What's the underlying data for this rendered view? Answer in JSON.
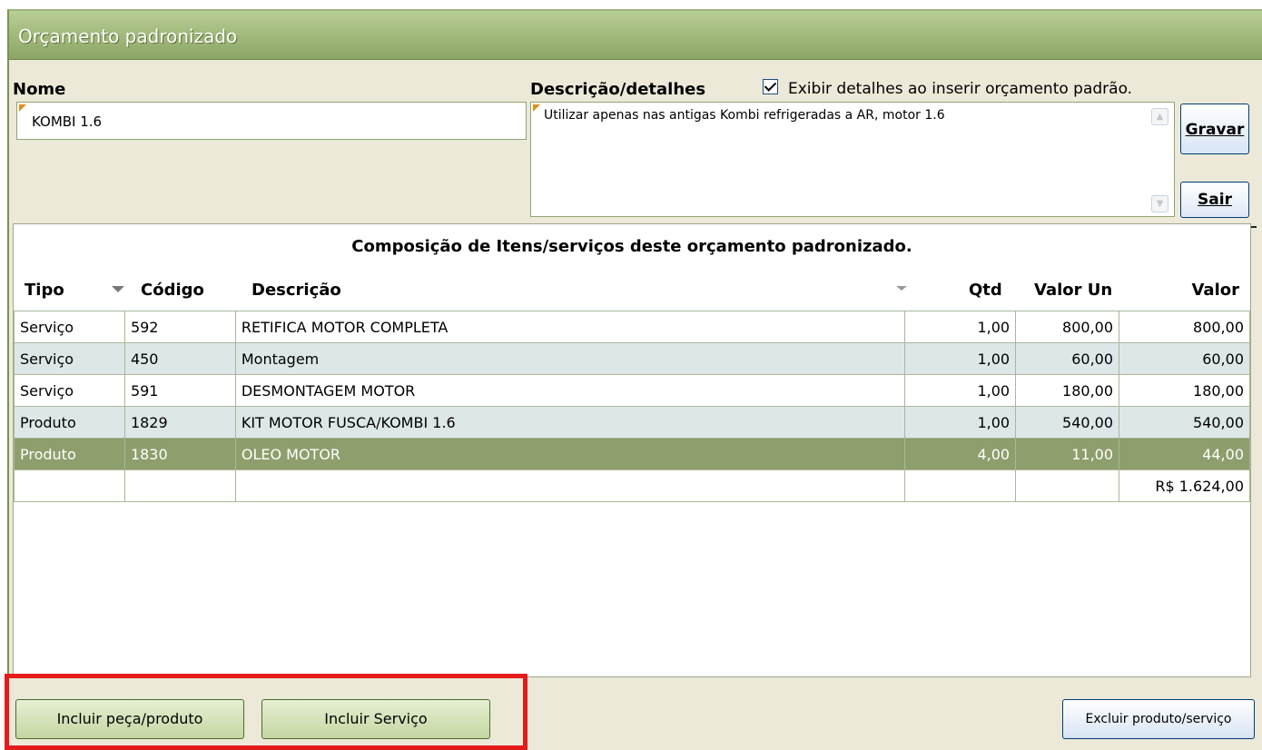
{
  "window": {
    "title": "Orçamento padronizado"
  },
  "form": {
    "nome_label": "Nome",
    "nome_value": "KOMBI 1.6",
    "descricao_label": "Descrição/detalhes",
    "descricao_value": "Utilizar apenas nas antigas Kombi refrigeradas a AR, motor 1.6",
    "exibir_label": "Exibir detalhes ao inserir orçamento padrão.",
    "exibir_checked": true
  },
  "buttons": {
    "gravar_label": "Gravar",
    "sair_label": "Sair",
    "incluir_peca_label": "Incluir peça/produto",
    "incluir_servico_label": "Incluir Serviço",
    "excluir_label": "Excluir produto/serviço"
  },
  "grid": {
    "title": "Composição de Itens/serviços deste orçamento padronizado.",
    "columns": [
      "Tipo",
      "Código",
      "Descrição",
      "Qtd",
      "Valor Un",
      "Valor"
    ],
    "rows": [
      {
        "tipo": "Serviço",
        "codigo": "592",
        "descricao": "RETIFICA MOTOR COMPLETA",
        "qtd": "1,00",
        "valor_un": "800,00",
        "valor": "800,00"
      },
      {
        "tipo": "Serviço",
        "codigo": "450",
        "descricao": "Montagem",
        "qtd": "1,00",
        "valor_un": "60,00",
        "valor": "60,00"
      },
      {
        "tipo": "Serviço",
        "codigo": "591",
        "descricao": "DESMONTAGEM MOTOR",
        "qtd": "1,00",
        "valor_un": "180,00",
        "valor": "180,00"
      },
      {
        "tipo": "Produto",
        "codigo": "1829",
        "descricao": "KIT MOTOR FUSCA/KOMBI 1.6",
        "qtd": "1,00",
        "valor_un": "540,00",
        "valor": "540,00"
      },
      {
        "tipo": "Produto",
        "codigo": "1830",
        "descricao": "OLEO MOTOR",
        "qtd": "4,00",
        "valor_un": "11,00",
        "valor": "44,00"
      }
    ],
    "total": "R$ 1.624,00"
  },
  "colors": {
    "titlebar": "#a4bb7e",
    "selected_row": "#8e9e6c",
    "alt_row": "#dde7e7",
    "highlight": "#e51b1b"
  }
}
